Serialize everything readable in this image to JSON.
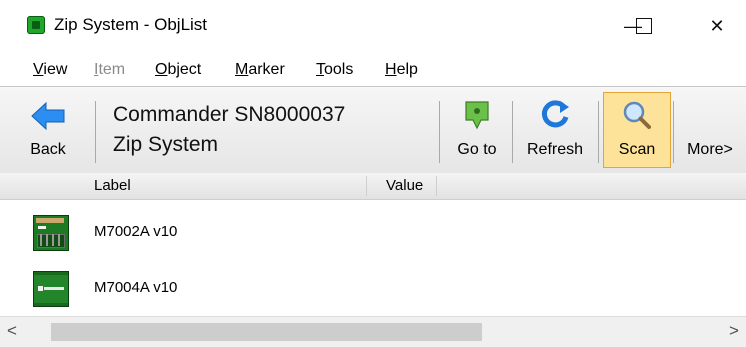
{
  "window": {
    "title": "Zip System - ObjList",
    "minimize_glyph": "—",
    "maximize_glyph": "☐",
    "close_glyph": "✕"
  },
  "menu": {
    "view": {
      "first": "V",
      "rest": "iew"
    },
    "item": {
      "first": "I",
      "rest": "tem"
    },
    "object": {
      "first": "O",
      "rest": "bject"
    },
    "marker": {
      "first": "M",
      "rest": "arker"
    },
    "tools": {
      "first": "T",
      "rest": "ools"
    },
    "help": {
      "first": "H",
      "rest": "elp"
    }
  },
  "toolbar": {
    "back_label": "Back",
    "breadcrumb_line1": "Commander SN8000037",
    "breadcrumb_line2": "Zip System",
    "goto_label": "Go to",
    "refresh_label": "Refresh",
    "scan_label": "Scan",
    "more_label": "More>"
  },
  "table": {
    "columns": [
      "Label",
      "Value"
    ],
    "rows": [
      {
        "label": "M7002A v10",
        "value": "",
        "icon": "circuit-board-icon"
      },
      {
        "label": "M7004A v10",
        "value": "",
        "icon": "circuit-board-icon"
      }
    ]
  },
  "scrollbar": {
    "left_arrow": "<",
    "right_arrow": ">"
  },
  "colors": {
    "app_green": "#1fa72b",
    "scan_highlight": "#fde29a",
    "back_blue": "#1e90ff"
  }
}
